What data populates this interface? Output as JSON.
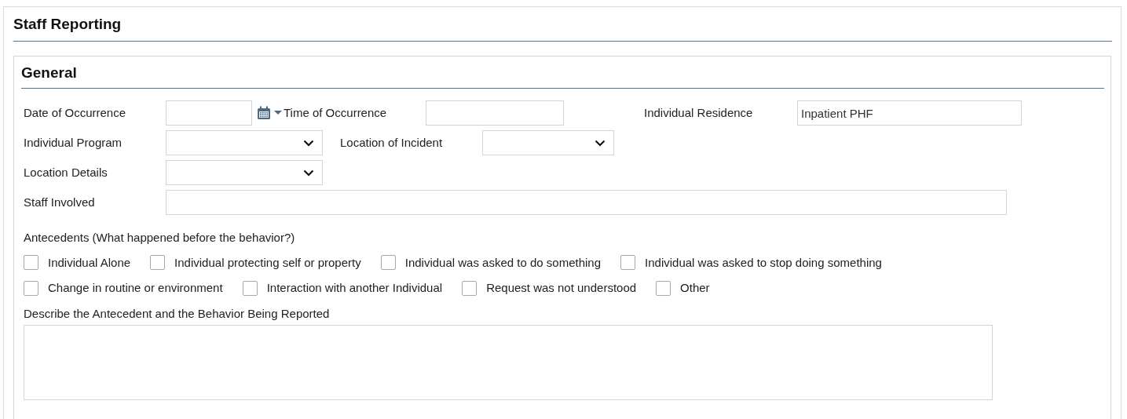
{
  "title": "Staff Reporting",
  "section": {
    "title": "General",
    "rows": [
      [
        {
          "label": "Date of Occurrence",
          "kind": "date"
        },
        {
          "label": "Time of Occurrence",
          "kind": "text"
        },
        {
          "label": "Individual Residence",
          "kind": "text",
          "value": "Inpatient PHF"
        }
      ],
      [
        {
          "label": "Individual Program",
          "kind": "select"
        },
        {
          "label": "Location of Incident",
          "kind": "select"
        }
      ],
      [
        {
          "label": "Location Details",
          "kind": "select"
        }
      ],
      [
        {
          "label": "Staff Involved",
          "kind": "text"
        }
      ]
    ],
    "antecedents": {
      "label": "Antecedents (What happened before the behavior?)",
      "options": [
        [
          {
            "label": "Individual Alone",
            "checked": false
          },
          {
            "label": "Individual protecting self or property",
            "checked": false
          },
          {
            "label": "Individual was asked to do something",
            "checked": false
          },
          {
            "label": "Individual was asked to stop doing something",
            "checked": false
          }
        ],
        [
          {
            "label": "Change in routine or environment",
            "checked": false
          },
          {
            "label": "Interaction with another Individual",
            "checked": false
          },
          {
            "label": "Request was not understood",
            "checked": false
          },
          {
            "label": "Other",
            "checked": false
          }
        ]
      ]
    },
    "description": {
      "label": "Describe the Antecedent and the Behavior Being Reported"
    }
  }
}
